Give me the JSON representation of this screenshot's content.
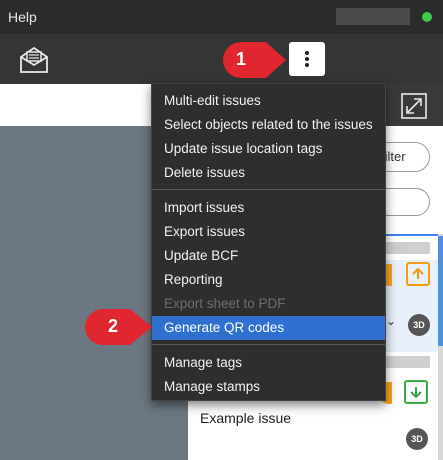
{
  "titlebar": {
    "help": "Help"
  },
  "filter": {
    "label": "filter"
  },
  "issues": {
    "example_title": "Example issue",
    "badge_3d": "3D",
    "expand_chevron": "⌄"
  },
  "menu": {
    "group1": [
      "Multi-edit issues",
      "Select objects related to the issues",
      "Update issue location tags",
      "Delete issues"
    ],
    "group2": [
      "Import issues",
      "Export issues",
      "Update BCF",
      "Reporting",
      "Export sheet to PDF",
      "Generate QR codes"
    ],
    "group3": [
      "Manage tags",
      "Manage stamps"
    ],
    "disabled_item": "Export sheet to PDF",
    "highlighted_item": "Generate QR codes"
  },
  "callouts": {
    "step1": "1",
    "step2": "2"
  },
  "colors": {
    "accent": "#2f6fd0",
    "callout": "#e0262e",
    "status": "#3ec94a",
    "orange": "#f39c12",
    "green": "#39a845"
  },
  "icons": [
    "envelope-icon",
    "more-vertical-icon",
    "expand-icon",
    "arrow-up-icon",
    "arrow-down-icon",
    "chevron-down-icon"
  ]
}
